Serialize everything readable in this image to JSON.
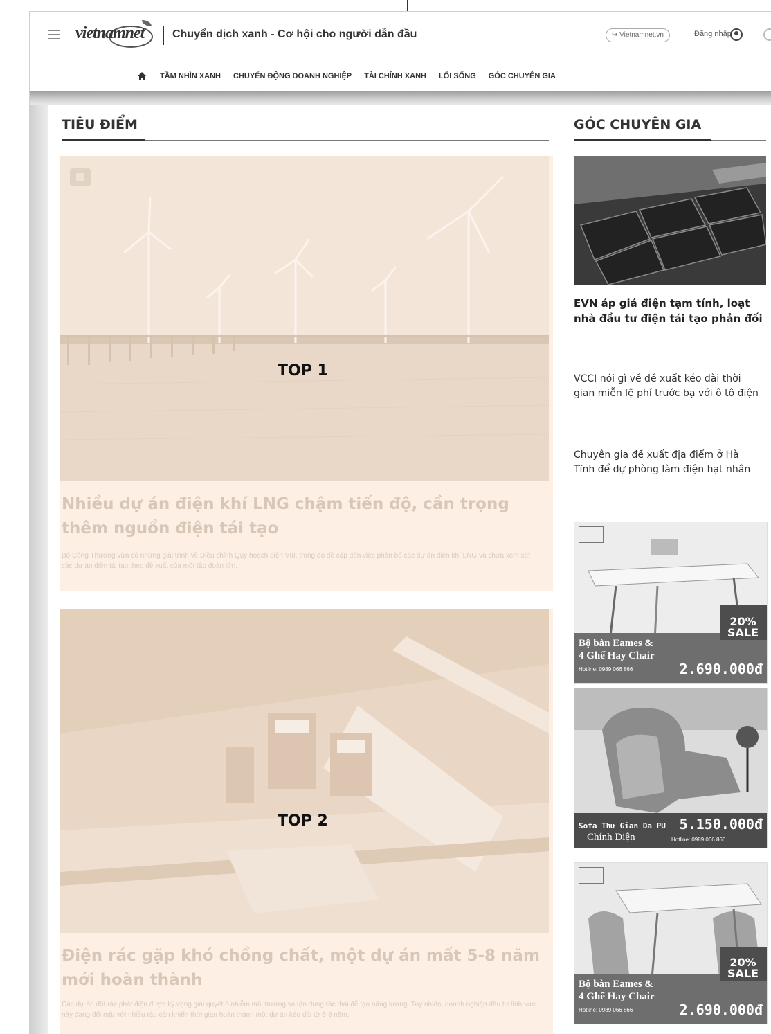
{
  "header": {
    "site_title": "Chuyển dịch xanh - Cơ hội cho người dẫn đầu",
    "vnnet_link": "Vietnamnet.vn",
    "login": "Đăng nhập",
    "logo_text": "vietnamnet"
  },
  "nav": {
    "items": [
      "TẦM NHÌN XANH",
      "CHUYỂN ĐỘNG DOANH NGHIỆP",
      "TÀI CHÍNH XANH",
      "LỐI SỐNG",
      "GÓC CHUYÊN GIA"
    ]
  },
  "main": {
    "section_title": "TIÊU ĐIỂM",
    "cards": [
      {
        "label": "TOP 1",
        "title": "Nhiều dự án điện khí LNG chậm tiến độ, cần trọng thêm nguồn điện tái tạo",
        "sapo": "Bộ Công Thương vừa có những giải trình về Điều chỉnh Quy hoạch điện VIII, trong đó đề cập đến việc phân bổ các dự án điện khí LNG và chưa xem xét các dự án điện tái tạo theo đề xuất của một tập đoàn lớn."
      },
      {
        "label": "TOP 2",
        "title": "Điện rác gặp khó chồng chất, một dự án mất 5-8 năm mới hoàn thành",
        "sapo": "Các dự án đốt rác phát điện được kỳ vọng giải quyết ô nhiễm môi trường và tận dụng rác thải để tạo năng lượng. Tuy nhiên, doanh nghiệp đầu tư lĩnh vực này đang đối mặt với nhiều rào cản khiến thời gian hoàn thành một dự án kéo dài từ 5-8 năm."
      }
    ]
  },
  "sidebar": {
    "section_title": "GÓC CHUYÊN GIA",
    "lead_title": "EVN áp giá điện tạm tính, loạt nhà đầu tư điện tái tạo phản đối",
    "items": [
      "VCCI nói gì về đề xuất kéo dài thời gian miễn lệ phí trước bạ với ô tô điện",
      "Chuyên gia đề xuất địa điểm ở Hà Tĩnh để dự phòng làm điện hạt nhân"
    ],
    "ads": [
      {
        "title_line1": "Bộ bàn Eames &",
        "title_line2": "4 Ghế Hay Chair",
        "hotline": "Hotline: 0989 066 866",
        "price": "2.690.000đ",
        "sale_pct": "20%",
        "sale_word": "SALE"
      },
      {
        "title_line1": "Sofa Thư Giãn Da PU",
        "title_line2": "Chính Điện",
        "hotline": "Hotline: 0989 066 866",
        "price": "5.150.000đ"
      },
      {
        "title_line1": "Bộ bàn Eames &",
        "title_line2": "4 Ghế Hay Chair",
        "hotline": "Hotline: 0989 066 866",
        "price": "2.690.000đ",
        "sale_pct": "20%",
        "sale_word": "SALE"
      }
    ]
  },
  "colors": {
    "card_bg": "#fdefe3",
    "title_faded": "#d8c7b8",
    "text_dark": "#222222"
  }
}
